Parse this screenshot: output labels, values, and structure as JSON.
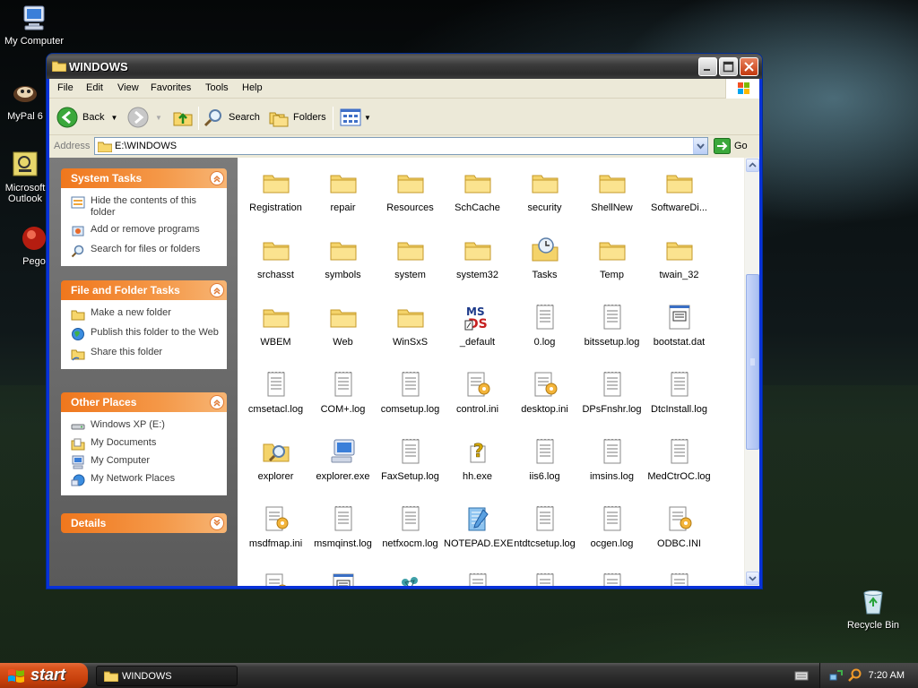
{
  "desktop": {
    "icons": [
      {
        "label": "My Computer",
        "name": "desktop-icon-my-computer"
      },
      {
        "label": "MyPal 6",
        "name": "desktop-icon-mypal"
      },
      {
        "label": "Microsoft Outlook",
        "name": "desktop-icon-outlook"
      },
      {
        "label": "Pego",
        "name": "desktop-icon-pego"
      },
      {
        "label": "Recycle Bin",
        "name": "desktop-icon-recycle-bin"
      }
    ]
  },
  "window": {
    "title": "WINDOWS",
    "menu": [
      "File",
      "Edit",
      "View",
      "Favorites",
      "Tools",
      "Help"
    ],
    "toolbar": {
      "back": "Back",
      "search": "Search",
      "folders": "Folders"
    },
    "address": {
      "label": "Address",
      "value": "E:\\WINDOWS",
      "go": "Go"
    }
  },
  "taskpane": {
    "groups": [
      {
        "title": "System Tasks",
        "links": [
          "Hide the contents of this folder",
          "Add or remove programs",
          "Search for files or folders"
        ]
      },
      {
        "title": "File and Folder Tasks",
        "links": [
          "Make a new folder",
          "Publish this folder to the Web",
          "Share this folder"
        ]
      },
      {
        "title": "Other Places",
        "links": [
          "Windows XP (E:)",
          "My Documents",
          "My Computer",
          "My Network Places"
        ]
      },
      {
        "title": "Details",
        "links": []
      }
    ]
  },
  "files": [
    {
      "name": "Registration",
      "icon": "folder"
    },
    {
      "name": "repair",
      "icon": "folder"
    },
    {
      "name": "Resources",
      "icon": "folder"
    },
    {
      "name": "SchCache",
      "icon": "folder"
    },
    {
      "name": "security",
      "icon": "folder"
    },
    {
      "name": "ShellNew",
      "icon": "folder"
    },
    {
      "name": "SoftwareDi...",
      "icon": "folder"
    },
    {
      "name": "srchasst",
      "icon": "folder"
    },
    {
      "name": "symbols",
      "icon": "folder"
    },
    {
      "name": "system",
      "icon": "folder"
    },
    {
      "name": "system32",
      "icon": "folder"
    },
    {
      "name": "Tasks",
      "icon": "tasks-folder"
    },
    {
      "name": "Temp",
      "icon": "folder"
    },
    {
      "name": "twain_32",
      "icon": "folder"
    },
    {
      "name": "WBEM",
      "icon": "folder"
    },
    {
      "name": "Web",
      "icon": "folder"
    },
    {
      "name": "WinSxS",
      "icon": "folder"
    },
    {
      "name": "_default",
      "icon": "ms-pif"
    },
    {
      "name": "0.log",
      "icon": "text-file"
    },
    {
      "name": "bitssetup.log",
      "icon": "text-file"
    },
    {
      "name": "bootstat.dat",
      "icon": "dat-file"
    },
    {
      "name": "cmsetacl.log",
      "icon": "text-file"
    },
    {
      "name": "COM+.log",
      "icon": "text-file"
    },
    {
      "name": "comsetup.log",
      "icon": "text-file"
    },
    {
      "name": "control.ini",
      "icon": "ini-file"
    },
    {
      "name": "desktop.ini",
      "icon": "ini-file"
    },
    {
      "name": "DPsFnshr.log",
      "icon": "text-file"
    },
    {
      "name": "DtcInstall.log",
      "icon": "text-file"
    },
    {
      "name": "explorer",
      "icon": "search-folder"
    },
    {
      "name": "explorer.exe",
      "icon": "computer"
    },
    {
      "name": "FaxSetup.log",
      "icon": "text-file"
    },
    {
      "name": "hh.exe",
      "icon": "help-exe"
    },
    {
      "name": "iis6.log",
      "icon": "text-file"
    },
    {
      "name": "imsins.log",
      "icon": "text-file"
    },
    {
      "name": "MedCtrOC.log",
      "icon": "text-file"
    },
    {
      "name": "msdfmap.ini",
      "icon": "ini-file"
    },
    {
      "name": "msmqinst.log",
      "icon": "text-file"
    },
    {
      "name": "netfxocm.log",
      "icon": "text-file"
    },
    {
      "name": "NOTEPAD.EXE",
      "icon": "notepad"
    },
    {
      "name": "ntdtcsetup.log",
      "icon": "text-file"
    },
    {
      "name": "ocgen.log",
      "icon": "text-file"
    },
    {
      "name": "ODBC.INI",
      "icon": "ini-file"
    },
    {
      "name": "",
      "icon": "ini-file"
    },
    {
      "name": "",
      "icon": "dat-file"
    },
    {
      "name": "",
      "icon": "network-exe"
    },
    {
      "name": "",
      "icon": "text-file"
    },
    {
      "name": "",
      "icon": "text-file"
    },
    {
      "name": "",
      "icon": "text-file"
    },
    {
      "name": "",
      "icon": "text-file"
    }
  ],
  "taskbar": {
    "start": "start",
    "task": "WINDOWS",
    "clock": "7:20 AM"
  },
  "colors": {
    "taskpane_header": "#f0771d",
    "title_bar": "#3a3a3a",
    "start_button": "#c63f0b"
  }
}
